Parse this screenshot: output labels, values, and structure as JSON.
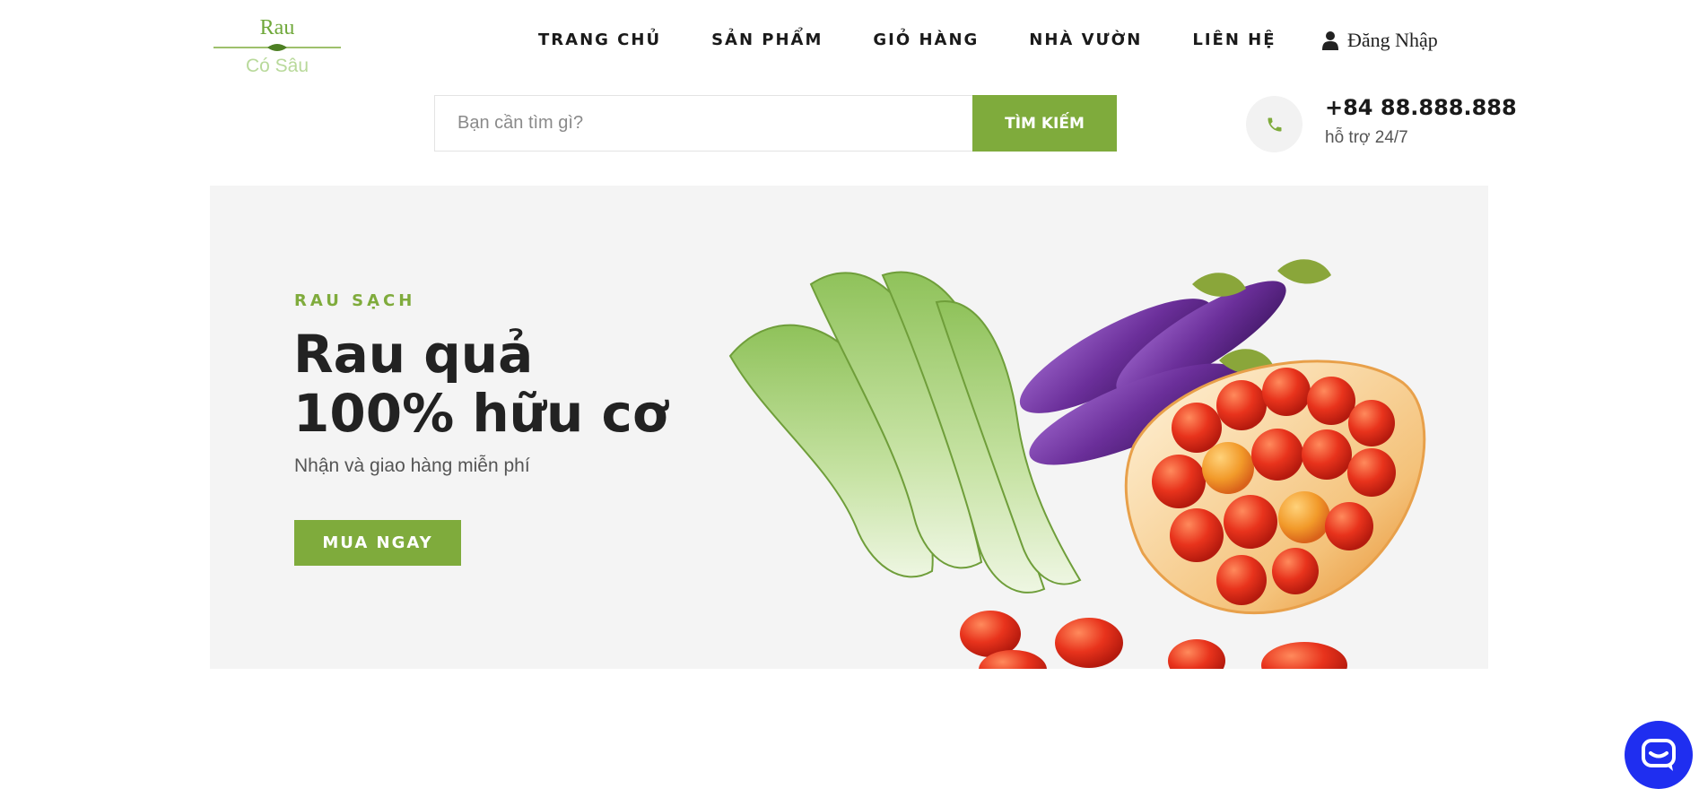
{
  "brand": {
    "logo_top": "Rau",
    "logo_bottom": "Có Sâu",
    "accent_color": "#7fab3c",
    "logo_icon": "leaf-divider-icon"
  },
  "nav": {
    "items": [
      {
        "label": "TRANG CHỦ"
      },
      {
        "label": "SẢN PHẨM"
      },
      {
        "label": "GIỎ HÀNG"
      },
      {
        "label": "NHÀ VƯỜN"
      },
      {
        "label": "LIÊN HỆ"
      }
    ]
  },
  "login": {
    "label": "Đăng Nhập",
    "icon": "user-icon"
  },
  "search": {
    "placeholder": "Bạn cần tìm gì?",
    "value": "",
    "button_label": "TÌM KIẾM"
  },
  "contact": {
    "phone": "+84 88.888.888",
    "support": "hỗ trợ 24/7",
    "icon": "phone-icon"
  },
  "hero": {
    "eyebrow": "RAU SẠCH",
    "title_line1": "Rau quả",
    "title_line2": "100% hữu cơ",
    "subtitle": "Nhận và giao hàng miễn phí",
    "cta_label": "MUA NGAY",
    "image": "vegetables-illustration"
  },
  "chat": {
    "icon": "chat-bubble-icon",
    "color": "#1f2ef0"
  }
}
